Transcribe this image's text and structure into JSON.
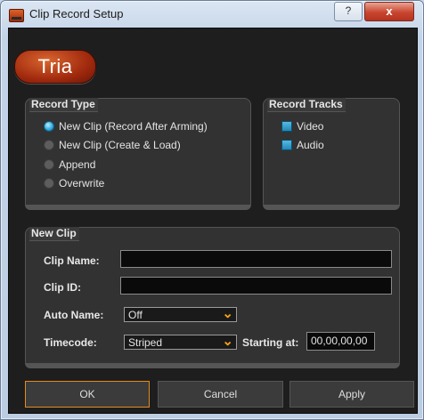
{
  "window": {
    "title": "Clip Record Setup",
    "help_label": "?",
    "close_label": "x"
  },
  "logo": {
    "text": "Tria"
  },
  "record_type": {
    "label": "Record Type",
    "options": [
      {
        "label": "New Clip (Record After Arming)",
        "selected": true
      },
      {
        "label": "New Clip (Create & Load)",
        "selected": false
      },
      {
        "label": "Append",
        "selected": false
      },
      {
        "label": "Overwrite",
        "selected": false
      }
    ]
  },
  "record_tracks": {
    "label": "Record Tracks",
    "tracks": [
      {
        "label": "Video",
        "checked": true
      },
      {
        "label": "Audio",
        "checked": true
      }
    ]
  },
  "new_clip": {
    "label": "New Clip",
    "clip_name": {
      "label": "Clip Name:",
      "value": ""
    },
    "clip_id": {
      "label": "Clip ID:",
      "value": ""
    },
    "auto_name": {
      "label": "Auto Name:",
      "value": "Off"
    },
    "timecode": {
      "label": "Timecode:",
      "value": "Striped"
    },
    "starting_at": {
      "label": "Starting at:",
      "value": "00,00,00,00"
    }
  },
  "buttons": {
    "ok": "OK",
    "cancel": "Cancel",
    "apply": "Apply"
  },
  "colors": {
    "accent_orange": "#e58a1e",
    "radio_blue": "#2aa6dc",
    "panel_bg": "#1e1e1e"
  }
}
